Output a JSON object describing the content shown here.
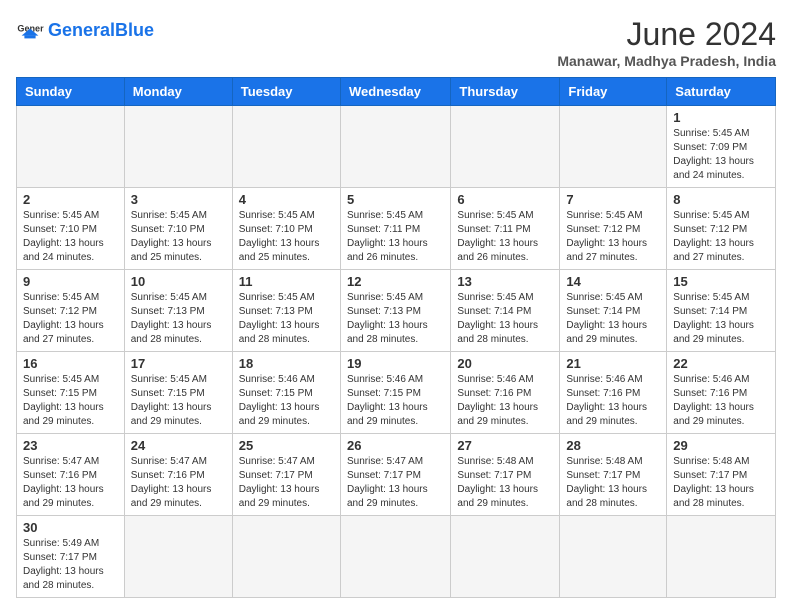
{
  "header": {
    "logo_general": "General",
    "logo_blue": "Blue",
    "month_year": "June 2024",
    "location": "Manawar, Madhya Pradesh, India"
  },
  "weekdays": [
    "Sunday",
    "Monday",
    "Tuesday",
    "Wednesday",
    "Thursday",
    "Friday",
    "Saturday"
  ],
  "weeks": [
    [
      {
        "day": "",
        "info": ""
      },
      {
        "day": "",
        "info": ""
      },
      {
        "day": "",
        "info": ""
      },
      {
        "day": "",
        "info": ""
      },
      {
        "day": "",
        "info": ""
      },
      {
        "day": "",
        "info": ""
      },
      {
        "day": "1",
        "info": "Sunrise: 5:45 AM\nSunset: 7:09 PM\nDaylight: 13 hours\nand 24 minutes."
      }
    ],
    [
      {
        "day": "2",
        "info": "Sunrise: 5:45 AM\nSunset: 7:10 PM\nDaylight: 13 hours\nand 24 minutes."
      },
      {
        "day": "3",
        "info": "Sunrise: 5:45 AM\nSunset: 7:10 PM\nDaylight: 13 hours\nand 25 minutes."
      },
      {
        "day": "4",
        "info": "Sunrise: 5:45 AM\nSunset: 7:10 PM\nDaylight: 13 hours\nand 25 minutes."
      },
      {
        "day": "5",
        "info": "Sunrise: 5:45 AM\nSunset: 7:11 PM\nDaylight: 13 hours\nand 26 minutes."
      },
      {
        "day": "6",
        "info": "Sunrise: 5:45 AM\nSunset: 7:11 PM\nDaylight: 13 hours\nand 26 minutes."
      },
      {
        "day": "7",
        "info": "Sunrise: 5:45 AM\nSunset: 7:12 PM\nDaylight: 13 hours\nand 27 minutes."
      },
      {
        "day": "8",
        "info": "Sunrise: 5:45 AM\nSunset: 7:12 PM\nDaylight: 13 hours\nand 27 minutes."
      }
    ],
    [
      {
        "day": "9",
        "info": "Sunrise: 5:45 AM\nSunset: 7:12 PM\nDaylight: 13 hours\nand 27 minutes."
      },
      {
        "day": "10",
        "info": "Sunrise: 5:45 AM\nSunset: 7:13 PM\nDaylight: 13 hours\nand 28 minutes."
      },
      {
        "day": "11",
        "info": "Sunrise: 5:45 AM\nSunset: 7:13 PM\nDaylight: 13 hours\nand 28 minutes."
      },
      {
        "day": "12",
        "info": "Sunrise: 5:45 AM\nSunset: 7:13 PM\nDaylight: 13 hours\nand 28 minutes."
      },
      {
        "day": "13",
        "info": "Sunrise: 5:45 AM\nSunset: 7:14 PM\nDaylight: 13 hours\nand 28 minutes."
      },
      {
        "day": "14",
        "info": "Sunrise: 5:45 AM\nSunset: 7:14 PM\nDaylight: 13 hours\nand 29 minutes."
      },
      {
        "day": "15",
        "info": "Sunrise: 5:45 AM\nSunset: 7:14 PM\nDaylight: 13 hours\nand 29 minutes."
      }
    ],
    [
      {
        "day": "16",
        "info": "Sunrise: 5:45 AM\nSunset: 7:15 PM\nDaylight: 13 hours\nand 29 minutes."
      },
      {
        "day": "17",
        "info": "Sunrise: 5:45 AM\nSunset: 7:15 PM\nDaylight: 13 hours\nand 29 minutes."
      },
      {
        "day": "18",
        "info": "Sunrise: 5:46 AM\nSunset: 7:15 PM\nDaylight: 13 hours\nand 29 minutes."
      },
      {
        "day": "19",
        "info": "Sunrise: 5:46 AM\nSunset: 7:15 PM\nDaylight: 13 hours\nand 29 minutes."
      },
      {
        "day": "20",
        "info": "Sunrise: 5:46 AM\nSunset: 7:16 PM\nDaylight: 13 hours\nand 29 minutes."
      },
      {
        "day": "21",
        "info": "Sunrise: 5:46 AM\nSunset: 7:16 PM\nDaylight: 13 hours\nand 29 minutes."
      },
      {
        "day": "22",
        "info": "Sunrise: 5:46 AM\nSunset: 7:16 PM\nDaylight: 13 hours\nand 29 minutes."
      }
    ],
    [
      {
        "day": "23",
        "info": "Sunrise: 5:47 AM\nSunset: 7:16 PM\nDaylight: 13 hours\nand 29 minutes."
      },
      {
        "day": "24",
        "info": "Sunrise: 5:47 AM\nSunset: 7:16 PM\nDaylight: 13 hours\nand 29 minutes."
      },
      {
        "day": "25",
        "info": "Sunrise: 5:47 AM\nSunset: 7:17 PM\nDaylight: 13 hours\nand 29 minutes."
      },
      {
        "day": "26",
        "info": "Sunrise: 5:47 AM\nSunset: 7:17 PM\nDaylight: 13 hours\nand 29 minutes."
      },
      {
        "day": "27",
        "info": "Sunrise: 5:48 AM\nSunset: 7:17 PM\nDaylight: 13 hours\nand 29 minutes."
      },
      {
        "day": "28",
        "info": "Sunrise: 5:48 AM\nSunset: 7:17 PM\nDaylight: 13 hours\nand 28 minutes."
      },
      {
        "day": "29",
        "info": "Sunrise: 5:48 AM\nSunset: 7:17 PM\nDaylight: 13 hours\nand 28 minutes."
      }
    ],
    [
      {
        "day": "30",
        "info": "Sunrise: 5:49 AM\nSunset: 7:17 PM\nDaylight: 13 hours\nand 28 minutes."
      },
      {
        "day": "",
        "info": ""
      },
      {
        "day": "",
        "info": ""
      },
      {
        "day": "",
        "info": ""
      },
      {
        "day": "",
        "info": ""
      },
      {
        "day": "",
        "info": ""
      },
      {
        "day": "",
        "info": ""
      }
    ]
  ]
}
